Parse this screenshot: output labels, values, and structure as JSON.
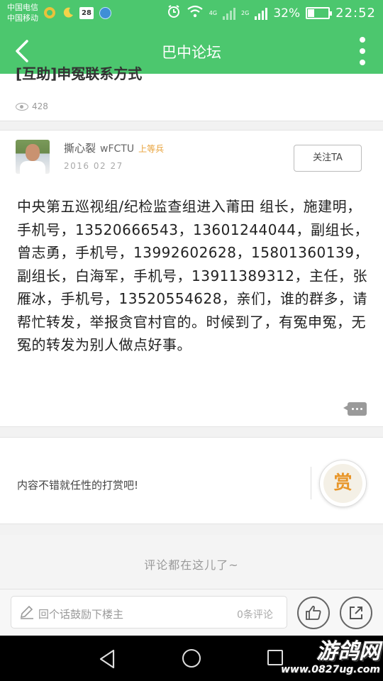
{
  "status_bar": {
    "carrier_1": "中国电信",
    "carrier_2": "中国移动",
    "calendar_day": "28",
    "net_top": "4G",
    "net_bottom": "2G",
    "battery": "32%",
    "battery_level": 0.32,
    "time": "22:52"
  },
  "header": {
    "title": "巴中论坛"
  },
  "post": {
    "title": "[互助]申冤联系方式",
    "views": "428",
    "author": "撕心裂",
    "author_id": "wFCTU",
    "rank": "上等兵",
    "date": "2016 02 27",
    "follow_label": "关注TA",
    "body": "中央第五巡视组/纪检监查组进入莆田 组长，施建明，手机号，13520666543，13601244044，副组长，曾志勇，手机号，13992602628，15801360139，副组长，白海军，手机号，13911389312，主任，张雁冰，手机号，13520554628，亲们，谁的群多，请帮忙转发，举报贪官村官的。时候到了，有冤申冤，无冤的转发为别人做点好事。"
  },
  "reward": {
    "prompt": "内容不错就任性的打赏吧!",
    "button_label": "赏"
  },
  "comments": {
    "empty_text": "评论都在这儿了~"
  },
  "input_bar": {
    "placeholder": "回个话鼓励下楼主",
    "comment_count": "0条评论"
  },
  "watermark": {
    "brand": "游鸽网",
    "url": "www.0827ug.com"
  },
  "colors": {
    "header_green": "#4cc76e",
    "rank_orange": "#e8a23a",
    "reward_orange": "#e8962a"
  }
}
